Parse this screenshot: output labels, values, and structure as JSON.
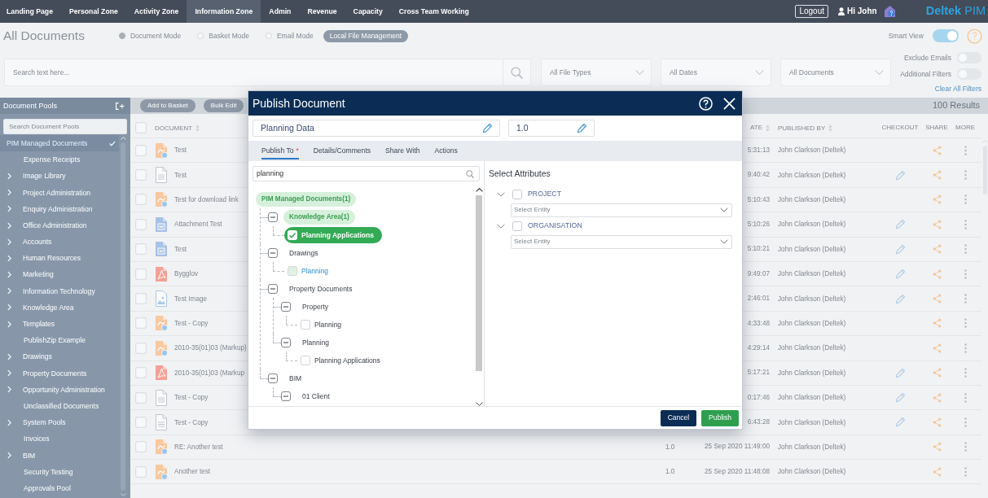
{
  "nav": {
    "items": [
      {
        "label": "Landing Page",
        "selected": false
      },
      {
        "label": "Personal Zone",
        "selected": false
      },
      {
        "label": "Activity Zone",
        "selected": false
      },
      {
        "label": "Information Zone",
        "selected": true
      },
      {
        "label": "Admin",
        "selected": false
      },
      {
        "label": "Revenue",
        "selected": false
      },
      {
        "label": "Capacity",
        "selected": false
      },
      {
        "label": "Cross Team Working",
        "selected": false
      }
    ],
    "logout": "Logout",
    "user": "Hi John",
    "logo": "**Deltek** PIM"
  },
  "page": {
    "title": "All Documents",
    "view_modes": [
      {
        "label": "Document Mode",
        "selected": true
      },
      {
        "label": "Basket Mode",
        "selected": false
      },
      {
        "label": "Email Mode",
        "selected": false
      }
    ],
    "local_files": "Local File Management",
    "smart_view": {
      "label": "Smart View",
      "on": true
    }
  },
  "filters": {
    "search": {
      "placeholder": "Search text here..."
    },
    "dropdowns": [
      {
        "value": "All File Types"
      },
      {
        "value": "All Dates"
      },
      {
        "value": "All Documents"
      }
    ],
    "toggles": [
      {
        "label": "Exclude Emails",
        "on": false
      },
      {
        "label": "Additional Filters",
        "on": false
      }
    ],
    "clear": "Clear All Filters"
  },
  "sidebar": {
    "title": "Document Pools",
    "search": {
      "placeholder": "Search Document Pools"
    },
    "pools": [
      {
        "label": "PIM Managed Documents",
        "selected": true,
        "expandable": false,
        "children": [
          {
            "label": "Expense Receipts",
            "expandable": false,
            "selected": false
          },
          {
            "label": "Image Library",
            "expandable": true,
            "selected": false
          },
          {
            "label": "Project Administration",
            "expandable": true,
            "selected": false
          },
          {
            "label": "Enquiry Administration",
            "expandable": true,
            "selected": false
          },
          {
            "label": "Office Administration",
            "expandable": true,
            "selected": false
          },
          {
            "label": "Accounts",
            "expandable": true,
            "selected": false
          },
          {
            "label": "Human Resources",
            "expandable": true,
            "selected": false
          },
          {
            "label": "Marketing",
            "expandable": true,
            "selected": false
          },
          {
            "label": "Information Technology",
            "expandable": true,
            "selected": false
          },
          {
            "label": "Knowledge Area",
            "expandable": true,
            "selected": false
          },
          {
            "label": "Templates",
            "expandable": true,
            "selected": false
          },
          {
            "label": "PublishZip Example",
            "expandable": false,
            "selected": false
          },
          {
            "label": "Drawings",
            "expandable": true,
            "selected": false
          },
          {
            "label": "Property Documents",
            "expandable": true,
            "selected": false
          },
          {
            "label": "Opportunity Administration",
            "expandable": true,
            "selected": false
          },
          {
            "label": "Unclassified Documents",
            "expandable": false,
            "selected": false
          },
          {
            "label": "System Pools",
            "expandable": true,
            "selected": false
          },
          {
            "label": "Invoices",
            "expandable": false,
            "selected": false
          },
          {
            "label": "BIM",
            "expandable": true,
            "selected": false
          },
          {
            "label": "Security Testing",
            "expandable": false,
            "selected": false
          },
          {
            "label": "Approvals Pool",
            "expandable": false,
            "selected": false
          }
        ]
      }
    ]
  },
  "table": {
    "toolbar": [
      "Add to Basket",
      "Bulk Edit"
    ],
    "results": "100 Results",
    "all_checked": false,
    "columns": [
      {
        "label": "DOCUMENT",
        "sortable": true
      },
      {
        "label": "ATE",
        "sortable": true
      },
      {
        "label": "PUBLISHED BY",
        "sortable": true
      },
      {
        "label": "CHECKOUT",
        "sortable": false
      },
      {
        "label": "SHARE",
        "sortable": false
      },
      {
        "label": "MORE",
        "sortable": false
      }
    ],
    "rows": [
      {
        "checked": false,
        "kind": "annotated",
        "name": "Test",
        "date": "5:31:13",
        "published_by": "John Clarkson (Deltek)",
        "checked_out": false
      },
      {
        "checked": false,
        "kind": "text",
        "name": "Test",
        "date": "9:40:42",
        "published_by": "John Clarkson (Deltek)",
        "checked_out": true
      },
      {
        "checked": false,
        "kind": "annotated",
        "name": "Test for download link",
        "date": "5:10:43",
        "published_by": "John Clarkson (Deltek)",
        "checked_out": false
      },
      {
        "checked": false,
        "kind": "doc",
        "name": "Attachment Test",
        "date": "5:10:26",
        "published_by": "John Clarkson (Deltek)",
        "checked_out": true
      },
      {
        "checked": false,
        "kind": "doc",
        "name": "Test",
        "date": "5:10:21",
        "published_by": "John Clarkson (Deltek)",
        "checked_out": true
      },
      {
        "checked": false,
        "kind": "pdf",
        "name": "Bygglov",
        "date": "9:49:07",
        "published_by": "John Clarkson (Deltek)",
        "checked_out": true
      },
      {
        "checked": false,
        "kind": "image",
        "name": "Test Image",
        "date": "2:46:01",
        "published_by": "John Clarkson (Deltek)",
        "checked_out": true
      },
      {
        "checked": false,
        "kind": "annotated",
        "name": "Test - Copy",
        "date": "4:33:48",
        "published_by": "John Clarkson (Deltek)",
        "checked_out": false
      },
      {
        "checked": false,
        "kind": "annotated",
        "name": "2010-35(01)03 (Markup)",
        "date": "4:29:14",
        "published_by": "John Clarkson (Deltek)",
        "checked_out": false
      },
      {
        "checked": false,
        "kind": "pdf",
        "name": "2010-35(01)03 (Markup",
        "date": "5:17:21",
        "published_by": "John Clarkson (Deltek)",
        "checked_out": true
      },
      {
        "checked": false,
        "kind": "text",
        "name": "Test - Copy",
        "date": "0:17:46",
        "published_by": "John Clarkson (Deltek)",
        "checked_out": true
      },
      {
        "checked": false,
        "kind": "text",
        "name": "Test - Copy",
        "date": "6:43:28",
        "published_by": "John Clarkson (Deltek)",
        "checked_out": true
      },
      {
        "checked": false,
        "kind": "annotated",
        "name": "RE: Another test",
        "version": "1.0",
        "date": "25 Sep 2020 11:49:00",
        "published_by": "John Clarkson (Deltek)",
        "checked_out": false
      },
      {
        "checked": false,
        "kind": "annotated",
        "name": "Another test",
        "version": "1.0",
        "date": "25 Sep 2020 11:48:08",
        "published_by": "John Clarkson (Deltek)",
        "checked_out": false
      }
    ]
  },
  "dialog": {
    "title": "Publish Document",
    "name_field": {
      "value": "Planning Data"
    },
    "version_field": {
      "value": "1.0"
    },
    "tabs": [
      {
        "label": "Publish To",
        "required_mark": "*",
        "selected": true
      },
      {
        "label": "Details/Comments",
        "selected": false
      },
      {
        "label": "Share With",
        "selected": false
      },
      {
        "label": "Actions",
        "selected": false
      }
    ],
    "tree_search": {
      "value": "planning"
    },
    "tree": {
      "label": "PIM Managed Documents(1)",
      "kind": "root",
      "highlighted": true,
      "children": [
        {
          "label": "Knowledge Area(1)",
          "kind": "branch",
          "expanded": true,
          "highlighted": true,
          "children": [
            {
              "label": "Planning Applications",
              "kind": "leaf",
              "checked": true,
              "focused": false
            }
          ]
        },
        {
          "label": "Drawings",
          "kind": "branch",
          "expanded": true,
          "highlighted": false,
          "children": [
            {
              "label": "Planning",
              "kind": "leaf",
              "checked": false,
              "focused": true
            }
          ]
        },
        {
          "label": "Property Documents",
          "kind": "branch",
          "expanded": true,
          "highlighted": false,
          "children": [
            {
              "label": "Property",
              "kind": "branch",
              "expanded": true,
              "highlighted": false,
              "children": [
                {
                  "label": "Planning",
                  "kind": "leaf",
                  "checked": false,
                  "focused": false
                }
              ]
            },
            {
              "label": "Planning",
              "kind": "branch",
              "expanded": true,
              "highlighted": false,
              "children": [
                {
                  "label": "Planning Applications",
                  "kind": "leaf",
                  "checked": false,
                  "focused": false
                }
              ]
            }
          ]
        },
        {
          "label": "BIM",
          "kind": "branch",
          "expanded": true,
          "highlighted": false,
          "children": [
            {
              "label": "01 Client",
              "kind": "branch",
              "expanded": true,
              "highlighted": false
            }
          ]
        }
      ]
    },
    "attributes_title": "Select Attributes",
    "attributes": [
      {
        "label": "PROJECT",
        "expanded": true,
        "checked": false,
        "placeholder": "Select Entity"
      },
      {
        "label": "ORGANISATION",
        "expanded": true,
        "checked": false,
        "placeholder": "Select Entity"
      }
    ],
    "buttons": [
      {
        "label": "Cancel",
        "kind": "secondary"
      },
      {
        "label": "Publish",
        "kind": "primary"
      }
    ]
  }
}
